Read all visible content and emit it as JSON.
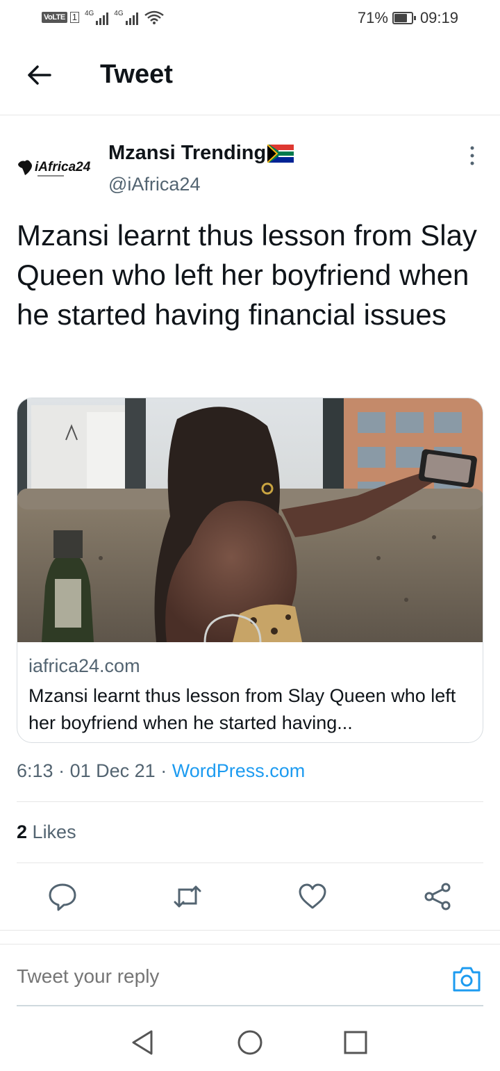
{
  "status_bar": {
    "volte": "VoLTE",
    "sim": "1",
    "network1": "4G",
    "network2": "4G",
    "battery_percent": "71%",
    "battery_level": 0.71,
    "time": "09:19"
  },
  "header": {
    "back_icon": "arrow-left-icon",
    "title": "Tweet"
  },
  "tweet": {
    "author_name": "Mzansi Trending",
    "flag": "🇿🇦",
    "handle": "@iAfrica24",
    "avatar_text": "iAfrica24",
    "text": "Mzansi learnt thus lesson from Slay Queen who left her boyfriend when he started having financial issues",
    "card": {
      "domain": "iafrica24.com",
      "title": "Mzansi learnt thus lesson from Slay Queen who left her boyfriend when he started having..."
    },
    "time": "6:13",
    "date": "01 Dec 21",
    "separator": "·",
    "source": "WordPress.com",
    "likes_count": "2",
    "likes_label": "Likes"
  },
  "actions": {
    "reply_icon": "reply-icon",
    "retweet_icon": "retweet-icon",
    "like_icon": "heart-icon",
    "share_icon": "share-icon"
  },
  "reply": {
    "placeholder": "Tweet your reply",
    "camera_icon": "camera-icon"
  },
  "colors": {
    "accent": "#1d9bf0",
    "secondary_text": "#536471",
    "primary_text": "#0f1419",
    "divider": "#e6e6e6"
  }
}
